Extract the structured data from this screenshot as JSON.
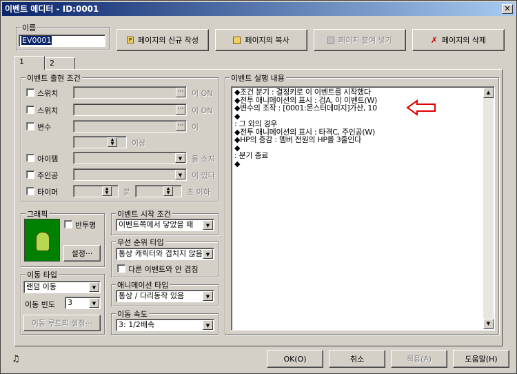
{
  "window": {
    "title": "이벤트 에디터 - ID:0001",
    "close_glyph": "✕"
  },
  "name_group": {
    "legend": "이름",
    "value": "EV0001"
  },
  "page_buttons": {
    "new_page": "페이지의 신규 작성",
    "copy_page": "페이지의 복사",
    "paste_page": "페이지 붙여 넣기",
    "delete_page": "페이지의 삭제"
  },
  "tabs": [
    "1",
    "2"
  ],
  "conditions": {
    "legend": "이벤트 출현 조건",
    "switch1": {
      "label": "스위치",
      "suffix": "이 ON"
    },
    "switch2": {
      "label": "스위치",
      "suffix": "이 ON"
    },
    "variable": {
      "label": "변수",
      "suffix": "이",
      "more": "이상"
    },
    "item": {
      "label": "아이템",
      "suffix": "을 소지"
    },
    "actor": {
      "label": "주인공",
      "suffix": "이 있다"
    },
    "timer": {
      "label": "타이머",
      "min": "분",
      "sec": "초 이하"
    },
    "ellipsis": "···"
  },
  "graphic": {
    "legend": "그래픽",
    "transparent": "반투명",
    "set_button": "설정···"
  },
  "trigger": {
    "legend": "이벤트 시작 조건",
    "value": "이벤트쪽에서 닿았을 때"
  },
  "priority": {
    "legend": "우선 순위 타입",
    "value": "통상 캐릭터와 겹치지 않음",
    "overlap": "다른 이벤트와 안 겹침"
  },
  "animation": {
    "legend": "애니메이션 타입",
    "value": "통상 / 다리동작 있음"
  },
  "move_type": {
    "legend": "이동 타입",
    "value": "랜덤 이동",
    "freq_label": "이동 빈도",
    "freq_value": "3",
    "route_button": "이동 루트의 설정···"
  },
  "move_speed": {
    "legend": "이동 속도",
    "value": "3: 1/2배속"
  },
  "commands": {
    "legend": "이벤트 실행 내용",
    "lines": [
      "◆조건 분기 : 결정키로 이 이벤트를 시작했다",
      "  ◆전투 애니메이션의 표시 : 검A, 이 이벤트(W)",
      "  ◆변수의 조작 : [0001:몬스터데미지]가산, 10",
      "  ◆",
      " : 그 외의 경우",
      "  ◆전투 애니메이션의 표시 : 타격C, 주인공(W)",
      "  ◆HP의 증감 : 멤버 전원의 HP를 3줄인다",
      "  ◆",
      " : 분기 종료",
      "◆"
    ]
  },
  "footer": {
    "ok": "OK(O)",
    "cancel": "취소",
    "apply": "적용(A)",
    "help": "도움말(H)",
    "music_glyph": "♫"
  },
  "colors": {
    "title_start": "#0a246a",
    "annotation_arrow": "#e00000",
    "sprite_bg": "#008000",
    "selection": "#0a246a"
  }
}
